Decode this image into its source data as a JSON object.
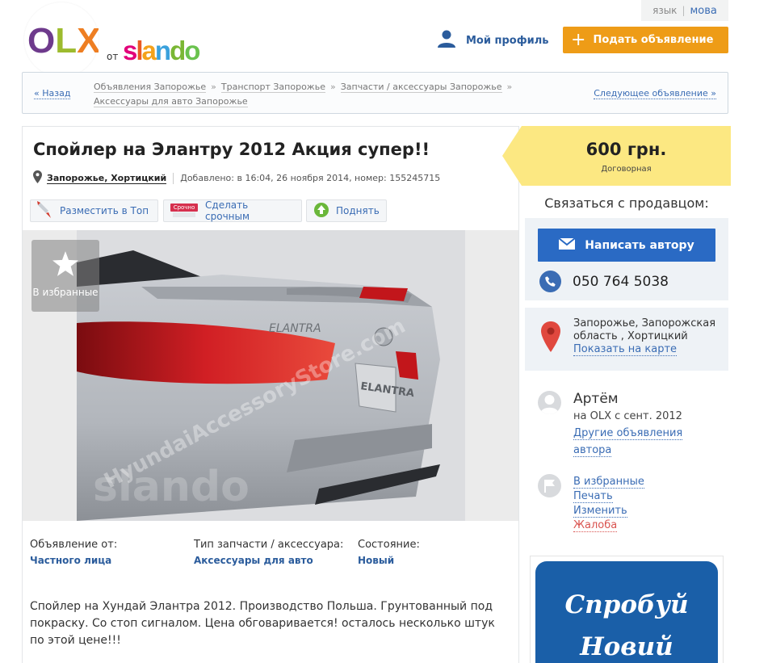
{
  "header": {
    "lang_ru": "язык",
    "lang_uk": "мова",
    "logo_text": "OLX",
    "logo_from": "от",
    "partner_logo": "slando",
    "profile_label": "Мой профиль",
    "post_ad_label": "Подать объявление"
  },
  "breadcrumb": {
    "back": "« Назад",
    "items": [
      "Объявления Запорожье",
      "Транспорт Запорожье",
      "Запчасти / аксессуары Запорожье",
      "Аксессуары для авто Запорожье"
    ],
    "next": "Следующее объявление »"
  },
  "ad": {
    "title": "Спойлер на Элантру 2012 Акция супер!!",
    "location": "Запорожье, Хортицкий",
    "added": "Добавлено: в 16:04, 26 ноября 2014, номер: 155245715",
    "actions": {
      "top": "Разместить в Топ",
      "urgent": "Сделать срочным",
      "urgent_badge": "Срочно",
      "raise": "Поднять"
    },
    "favorite": "В избранные",
    "photo_watermark": "HyundaiAccessoryStore.com",
    "photo_plate": "ELANTRA",
    "photo_logo": "slando",
    "attributes": [
      {
        "label": "Объявление от:",
        "value": "Частного лица"
      },
      {
        "label": "Тип запчасти / аксессуара:",
        "value": "Аксессуары для авто"
      },
      {
        "label": "Состояние:",
        "value": "Новый"
      }
    ],
    "description": "Спойлер на Хундай Элантра 2012. Производство Польша. Грунтованный под покраску. Со стоп сигналом. Цена обговаривается! осталось несколько штук по этой цене!!!"
  },
  "price": {
    "amount": "600 грн.",
    "note": "Договорная"
  },
  "contact": {
    "heading": "Связаться с продавцом:",
    "write_button": "Написать автору",
    "phone": "050 764 5038",
    "address": "Запорожье, Запорожская область , Хортицкий",
    "show_map": "Показать на карте"
  },
  "seller": {
    "name": "Артём",
    "since": "на OLX с сент. 2012",
    "other_ads": "Другие объявления автора"
  },
  "links": {
    "favorite": "В избранные",
    "print": "Печать",
    "edit": "Изменить",
    "report": "Жалоба"
  },
  "banner": {
    "line1": "Спробуй",
    "line2": "Новий"
  },
  "colors": {
    "accent_orange": "#ee9c17",
    "link_blue": "#3a6cb4",
    "button_blue": "#2a6ac4",
    "price_yellow": "#fce882",
    "report_red": "#d9534f"
  }
}
